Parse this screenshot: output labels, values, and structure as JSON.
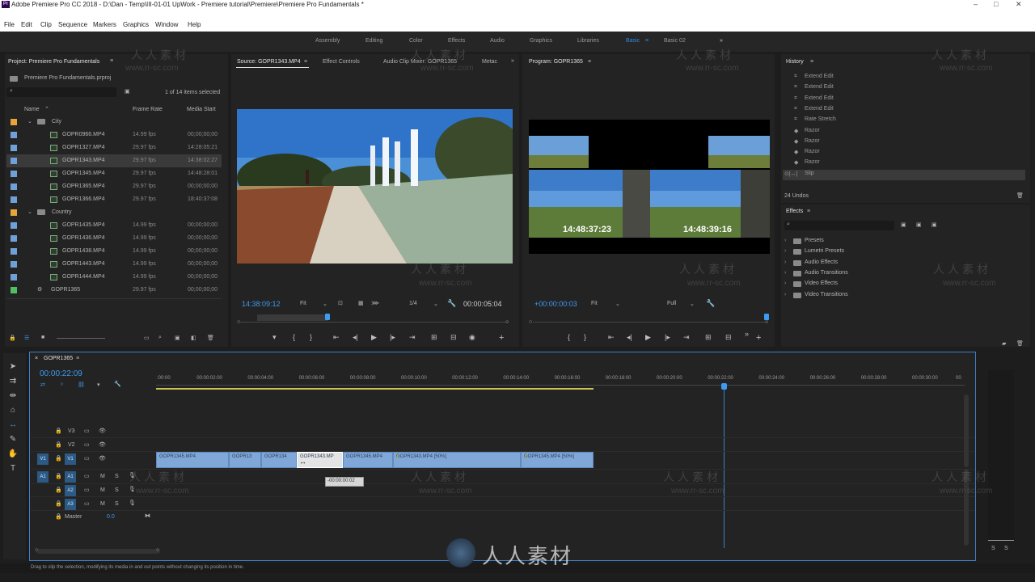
{
  "app": {
    "title": "Adobe Premiere Pro CC 2018 - D:\\Dan - Temp\\III-01-01 UpWork - Premiere tutorial\\Premiere\\Premiere Pro Fundamentals *"
  },
  "menu": [
    "File",
    "Edit",
    "Clip",
    "Sequence",
    "Markers",
    "Graphics",
    "Window",
    "Help"
  ],
  "workspaces": [
    "Assembly",
    "Editing",
    "Color",
    "Effects",
    "Audio",
    "Graphics",
    "Libraries",
    "Basic",
    "Basic 02"
  ],
  "workspaces_active": "Basic",
  "project": {
    "tab": "Project: Premiere Pro Fundamentals",
    "file": "Premiere Pro Fundamentals.prproj",
    "count": "1 of 14 items selected",
    "headers": [
      "Name",
      "Frame Rate",
      "Media Start"
    ],
    "rows": [
      {
        "name": "City",
        "fps": "",
        "start": "",
        "kind": "bin",
        "color": "#e8a33d"
      },
      {
        "name": "GOPR0966.MP4",
        "fps": "14.99 fps",
        "start": "00;00;00;00",
        "kind": "clip",
        "color": "#6fa0d8"
      },
      {
        "name": "GOPR1327.MP4",
        "fps": "29.97 fps",
        "start": "14:28:05:21",
        "kind": "clip",
        "color": "#6fa0d8"
      },
      {
        "name": "GOPR1343.MP4",
        "fps": "29.97 fps",
        "start": "14:38:02:27",
        "kind": "clip",
        "color": "#6fa0d8",
        "sel": true
      },
      {
        "name": "GOPR1345.MP4",
        "fps": "29.97 fps",
        "start": "14:48:28:01",
        "kind": "clip",
        "color": "#6fa0d8"
      },
      {
        "name": "GOPR1365.MP4",
        "fps": "29.97 fps",
        "start": "00;00;00;00",
        "kind": "clip",
        "color": "#6fa0d8"
      },
      {
        "name": "GOPR1366.MP4",
        "fps": "29.97 fps",
        "start": "18:40:37:08",
        "kind": "clip",
        "color": "#6fa0d8"
      },
      {
        "name": "Country",
        "fps": "",
        "start": "",
        "kind": "bin",
        "color": "#e8a33d"
      },
      {
        "name": "GOPR1435.MP4",
        "fps": "14.99 fps",
        "start": "00;00;00;00",
        "kind": "clip",
        "color": "#6fa0d8"
      },
      {
        "name": "GOPR1436.MP4",
        "fps": "14.99 fps",
        "start": "00;00;00;00",
        "kind": "clip",
        "color": "#6fa0d8"
      },
      {
        "name": "GOPR1438.MP4",
        "fps": "14.99 fps",
        "start": "00;00;00;00",
        "kind": "clip",
        "color": "#6fa0d8"
      },
      {
        "name": "GOPR1443.MP4",
        "fps": "14.99 fps",
        "start": "00;00;00;00",
        "kind": "clip",
        "color": "#6fa0d8"
      },
      {
        "name": "GOPR1444.MP4",
        "fps": "14.99 fps",
        "start": "00;00;00;00",
        "kind": "clip",
        "color": "#6fa0d8"
      },
      {
        "name": "GOPR1365",
        "fps": "29.97 fps",
        "start": "00;00;00;00",
        "kind": "seq",
        "color": "#4fbf5f"
      }
    ]
  },
  "source": {
    "tabs": [
      "Source: GOPR1343.MP4",
      "Effect Controls",
      "Audio Clip Mixer: GOPR1365",
      "Metac"
    ],
    "timecode": "14:38:09:12",
    "fit": "Fit",
    "res": "1/4",
    "duration": "00:00:05:04"
  },
  "program": {
    "tab": "Program: GOPR1365",
    "timecode": "+00:00:00:03",
    "fit": "Fit",
    "res": "Full",
    "tc_left": "14:48:37:23",
    "tc_right": "14:48:39:16"
  },
  "history": {
    "tab": "History",
    "items": [
      "Extend Edit",
      "Extend Edit",
      "Extend Edit",
      "Extend Edit",
      "Rate Stretch",
      "Razor",
      "Razor",
      "Razor",
      "Razor",
      "Slip"
    ],
    "undos": "24 Undos"
  },
  "effects": {
    "tab": "Effects",
    "items": [
      "Presets",
      "Lumetri Presets",
      "Audio Effects",
      "Audio Transitions",
      "Video Effects",
      "Video Transitions"
    ]
  },
  "timeline": {
    "tab": "GOPR1365",
    "timecode": "00:00:22:09",
    "ruler": [
      ":00:00",
      "00:00:02:00",
      "00:00:04:00",
      "00:00:06:00",
      "00:00:08:00",
      "00:00:10:00",
      "00:00:12:00",
      "00:00:14:00",
      "00:00:16:00",
      "00:00:18:00",
      "00:00:20:00",
      "00:00:22:00",
      "00:00:24:00",
      "00:00:26:00",
      "00:00:28:00",
      "00:00:30:00",
      "00"
    ],
    "tracks": [
      "V3",
      "V2",
      "V1",
      "A1",
      "A2",
      "A3"
    ],
    "src_v": "V1",
    "src_a": "A1",
    "master": "Master",
    "master_val": "0.0",
    "clips": [
      "GOPR1345.MP4",
      "GOPR13",
      "GOPR134",
      "GOPR1343.MP",
      "GOPR1345.MP4",
      "GOPR1343.MP4 [50%]",
      "GOPR1345.MP4 [50%]"
    ],
    "tooltip": "-00:00:00:02",
    "meter_labels": [
      "S",
      "S"
    ]
  },
  "status": "Drag to slip the selection, modifying its media in and out points without changing its position in time.",
  "watermark": {
    "cn": "人人素材",
    "url": "www.rr-sc.com"
  }
}
